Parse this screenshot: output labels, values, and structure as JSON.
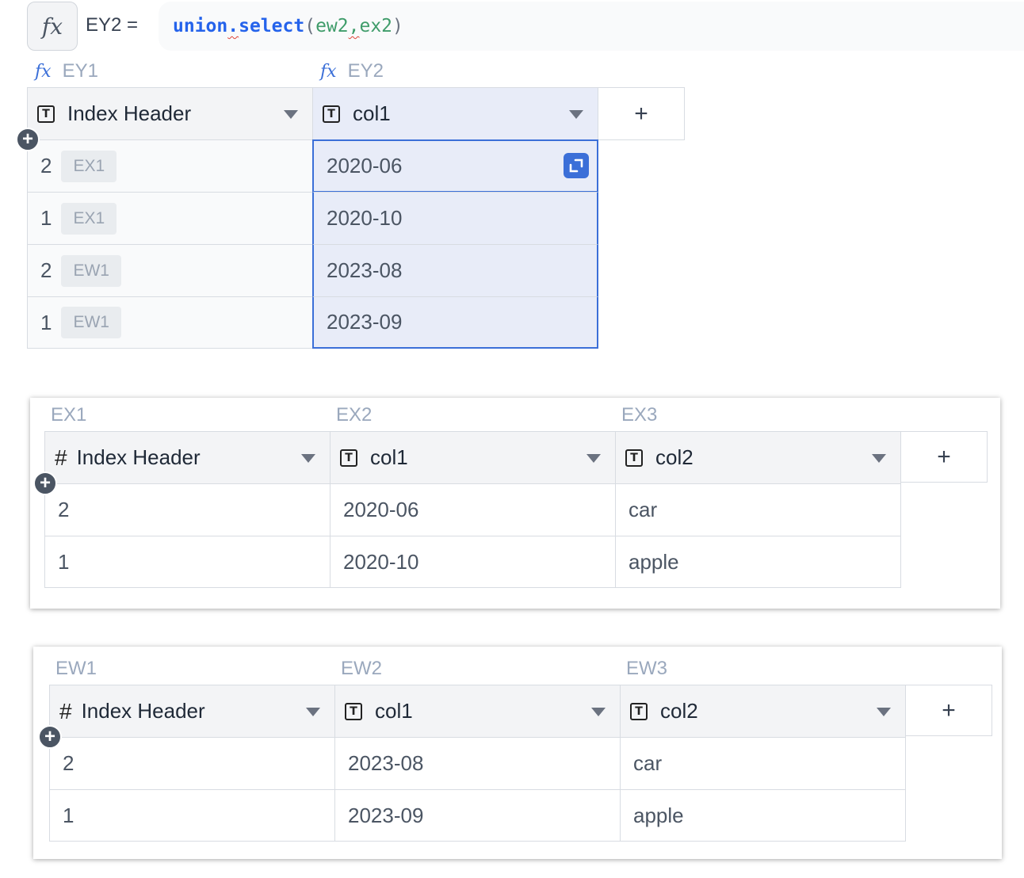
{
  "formula": {
    "fx_symbol": "fx",
    "name_label": "EY2 =",
    "fn_part1": "union",
    "dot": ".",
    "fn_part2": "select",
    "paren_open": "(",
    "arg1": "ew2",
    "comma": ",",
    "arg2": "ex2",
    "paren_close": ")"
  },
  "table_ey": {
    "columns": [
      {
        "label": "EY1",
        "header": "Index Header",
        "icon": "text-type-icon"
      },
      {
        "label": "EY2",
        "header": "col1",
        "icon": "text-type-icon"
      }
    ],
    "fx_symbol": "fx",
    "add_column": "+",
    "rows": [
      {
        "index": "2",
        "tag": "EX1",
        "col1": "2020-06"
      },
      {
        "index": "1",
        "tag": "EX1",
        "col1": "2020-10"
      },
      {
        "index": "2",
        "tag": "EW1",
        "col1": "2023-08"
      },
      {
        "index": "1",
        "tag": "EW1",
        "col1": "2023-09"
      }
    ]
  },
  "table_ex": {
    "columns": [
      {
        "label": "EX1",
        "header": "Index Header",
        "icon": "number-type-icon"
      },
      {
        "label": "EX2",
        "header": "col1",
        "icon": "text-type-icon"
      },
      {
        "label": "EX3",
        "header": "col2",
        "icon": "text-type-icon"
      }
    ],
    "add_column": "+",
    "rows": [
      {
        "index": "2",
        "col1": "2020-06",
        "col2": "car"
      },
      {
        "index": "1",
        "col1": "2020-10",
        "col2": "apple"
      }
    ]
  },
  "table_ew": {
    "columns": [
      {
        "label": "EW1",
        "header": "Index Header",
        "icon": "number-type-icon"
      },
      {
        "label": "EW2",
        "header": "col1",
        "icon": "text-type-icon"
      },
      {
        "label": "EW3",
        "header": "col2",
        "icon": "text-type-icon"
      }
    ],
    "add_column": "+",
    "rows": [
      {
        "index": "2",
        "col1": "2023-08",
        "col2": "car"
      },
      {
        "index": "1",
        "col1": "2023-09",
        "col2": "apple"
      }
    ]
  },
  "icons": {
    "text_type": "T",
    "number_type": "#",
    "add_row": "+"
  },
  "colors": {
    "accent": "#3b6fd8",
    "selected_column": "#e8ecf8",
    "header_bg": "#f3f4f6",
    "label_gray": "#9aa8bd"
  }
}
